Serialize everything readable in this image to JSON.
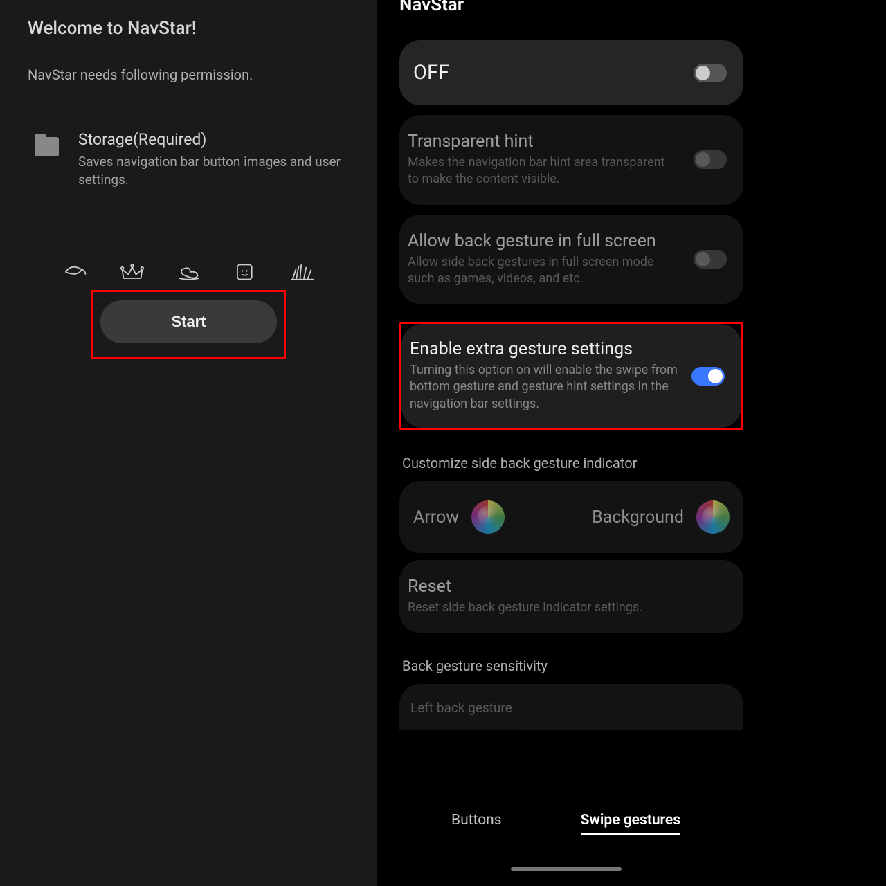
{
  "left": {
    "welcome_title": "Welcome to NavStar!",
    "permission_intro": "NavStar needs following permission.",
    "storage": {
      "title": "Storage(Required)",
      "desc": "Saves navigation bar button images and user settings."
    },
    "start_label": "Start"
  },
  "right": {
    "title": "NavStar",
    "main_toggle": {
      "label": "OFF",
      "state": false
    },
    "transparent_hint": {
      "title": "Transparent hint",
      "desc": "Makes the navigation bar hint area transparent to make the content visible.",
      "state": false
    },
    "allow_back_gesture": {
      "title": "Allow back gesture in full screen",
      "desc": "Allow side back gestures in full screen mode such as games, videos, and etc.",
      "state": false
    },
    "extra_gesture": {
      "title": "Enable extra gesture settings",
      "desc": "Turning this option on will enable the swipe from bottom gesture and gesture hint settings in the navigation bar settings.",
      "state": true
    },
    "customize_label": "Customize side back gesture indicator",
    "arrow_label": "Arrow",
    "background_label": "Background",
    "reset": {
      "title": "Reset",
      "desc": "Reset side back gesture indicator settings."
    },
    "sensitivity_label": "Back gesture sensitivity",
    "left_back_label": "Left back gesture",
    "tabs": {
      "buttons": "Buttons",
      "swipe": "Swipe gestures"
    }
  }
}
